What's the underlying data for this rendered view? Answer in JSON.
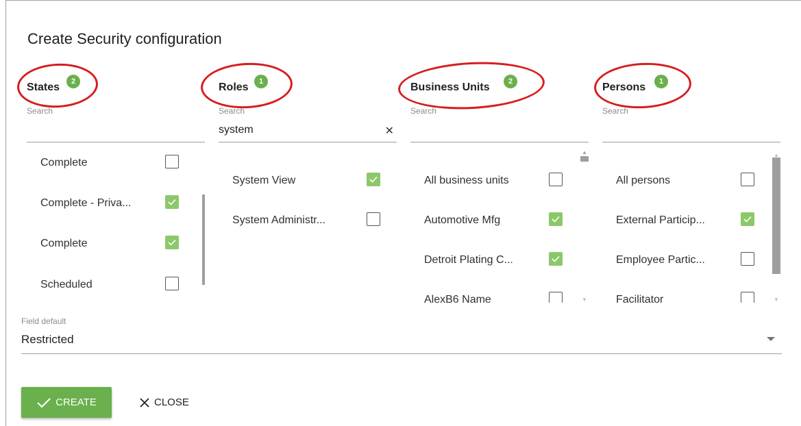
{
  "dialog": {
    "title": "Create Security configuration",
    "columns": [
      {
        "label": "States",
        "badge": "2",
        "search_label": "Search",
        "search_value": "",
        "items": [
          {
            "label": "Complete",
            "checked": false
          },
          {
            "label": "Complete - Priva...",
            "checked": true
          },
          {
            "label": "Complete",
            "checked": true
          },
          {
            "label": "Scheduled",
            "checked": false
          }
        ]
      },
      {
        "label": "Roles",
        "badge": "1",
        "search_label": "Search",
        "search_value": "system",
        "items": [
          {
            "label": "System View",
            "checked": true
          },
          {
            "label": "System Administr...",
            "checked": false
          }
        ]
      },
      {
        "label": "Business Units",
        "badge": "2",
        "search_label": "Search",
        "search_value": "",
        "items": [
          {
            "label": "All business units",
            "checked": false
          },
          {
            "label": "Automotive Mfg",
            "checked": true
          },
          {
            "label": "Detroit Plating C...",
            "checked": true
          },
          {
            "label": "AlexB6 Name",
            "checked": false
          }
        ]
      },
      {
        "label": "Persons",
        "badge": "1",
        "search_label": "Search",
        "search_value": "",
        "items": [
          {
            "label": "All persons",
            "checked": false
          },
          {
            "label": "External Particip...",
            "checked": true
          },
          {
            "label": "Employee Partic...",
            "checked": false
          },
          {
            "label": "Facilitator",
            "checked": false
          }
        ]
      }
    ],
    "field_default": {
      "label": "Field default",
      "value": "Restricted"
    },
    "buttons": {
      "create": "CREATE",
      "close": "CLOSE"
    },
    "colors": {
      "accent": "#6ab04c",
      "checkbox_checked": "#8cc86a",
      "annotation": "#d61d1d"
    }
  }
}
